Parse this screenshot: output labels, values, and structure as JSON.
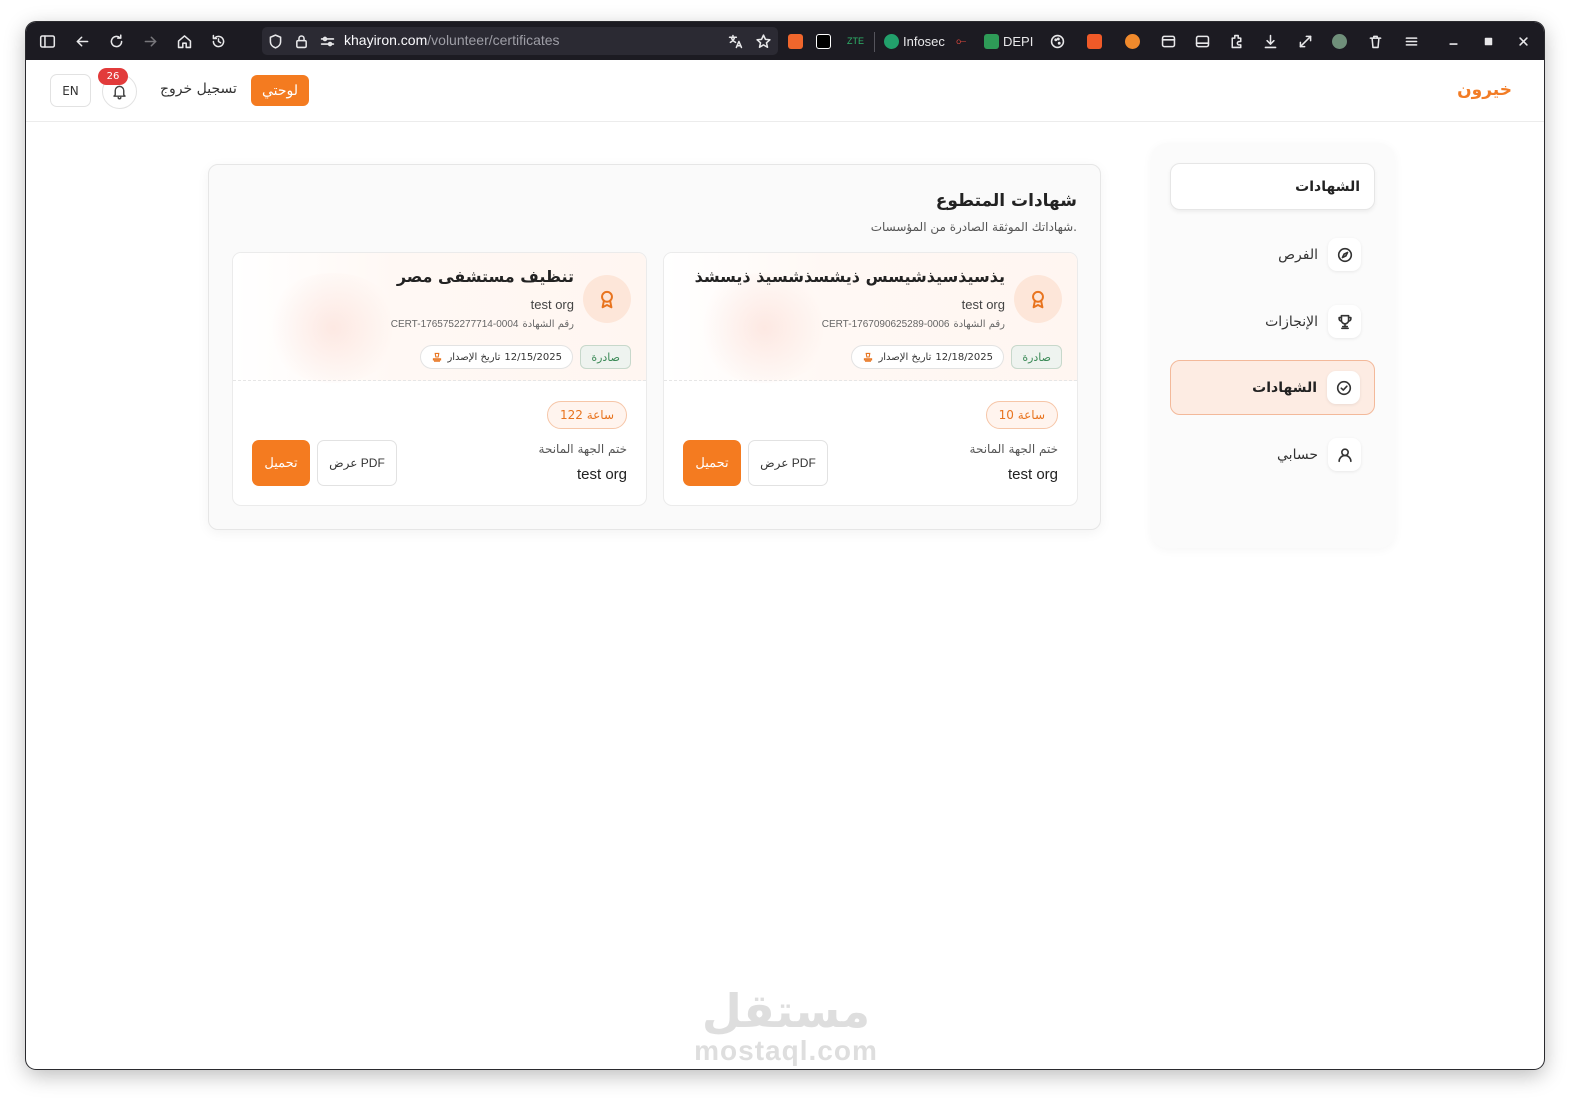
{
  "browser": {
    "url_domain": "khayiron.com",
    "url_path": "/volunteer/certificates",
    "extensions": {
      "zte": "ZTE",
      "infosec": "Infosec",
      "depi": "DEPI"
    }
  },
  "header": {
    "brand": "خيرون",
    "dashboard_label": "لوحتي",
    "logout_label": "تسجيل خروج",
    "notification_count": "26",
    "language_label": "EN"
  },
  "sidebar": {
    "heading": "الشهادات",
    "items": [
      {
        "label": "الفرص",
        "icon": "compass-icon",
        "active": false
      },
      {
        "label": "الإنجازات",
        "icon": "trophy-icon",
        "active": false
      },
      {
        "label": "الشهادات",
        "icon": "check-circle-icon",
        "active": true
      },
      {
        "label": "حسابي",
        "icon": "user-icon",
        "active": false
      }
    ]
  },
  "main": {
    "title": "شهادات المتطوع",
    "subtitle": "شهاداتك الموثقة الصادرة من المؤسسات.",
    "certificates": [
      {
        "title": "يذسيذسيذشيسس ذيشسذشسيذ ذيسشذ",
        "org": "test org",
        "number_label": "رقم الشهادة",
        "number": "CERT-1767090625289-0006",
        "status": "صادرة",
        "date_label": "تاريخ الإصدار",
        "date": "12/18/2025",
        "hours": "10 ساعة",
        "seal_label": "ختم الجهة المانحة",
        "seal_org": "test org",
        "view_label": "عرض PDF",
        "download_label": "تحميل"
      },
      {
        "title": "تنظيف مستشفى مصر",
        "org": "test org",
        "number_label": "رقم الشهادة",
        "number": "CERT-1765752277714-0004",
        "status": "صادرة",
        "date_label": "تاريخ الإصدار",
        "date": "12/15/2025",
        "hours": "122 ساعة",
        "seal_label": "ختم الجهة المانحة",
        "seal_org": "test org",
        "view_label": "عرض PDF",
        "download_label": "تحميل"
      }
    ]
  },
  "watermark": {
    "arabic": "مستقل",
    "latin": "mostaql.com"
  },
  "colors": {
    "accent": "#f47b20",
    "status_green": "#3b8a57",
    "active_bg": "#fdece3"
  }
}
